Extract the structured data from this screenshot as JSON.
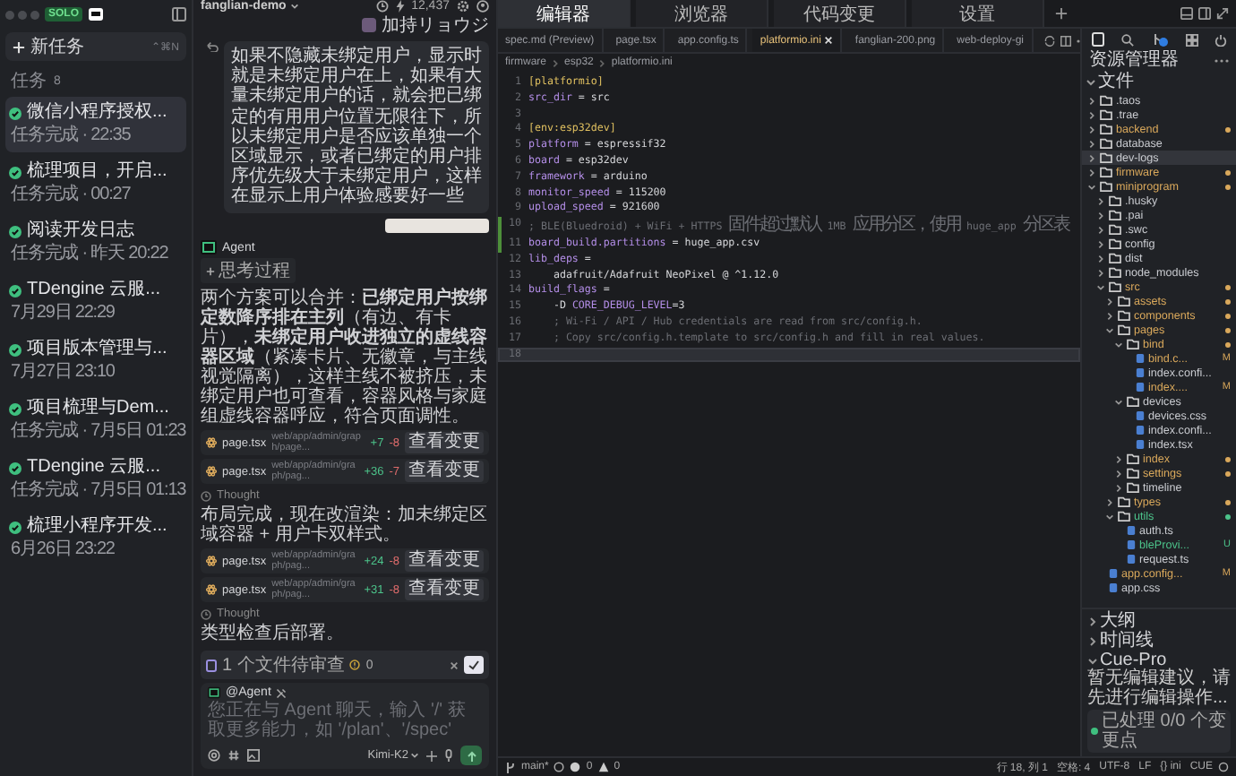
{
  "window": {
    "badge": "SOLO"
  },
  "sidebar": {
    "new_task": {
      "label": "新任务",
      "shortcut": "⌃⌘N"
    },
    "tasks_header": {
      "label": "任务",
      "count": "8"
    },
    "tasks": [
      {
        "title": "微信小程序授权...",
        "subtitle": "任务完成 · 22:35",
        "selected": true
      },
      {
        "title": "梳理项目，开启...",
        "subtitle": "任务完成 · 00:27",
        "selected": false
      },
      {
        "title": "阅读开发日志",
        "subtitle": "任务完成 · 昨天 20:22",
        "selected": false
      },
      {
        "title": "TDengine 云服...",
        "subtitle": "7月29日 22:29",
        "selected": false
      },
      {
        "title": "项目版本管理与...",
        "subtitle": "7月27日 23:10",
        "selected": false
      },
      {
        "title": "项目梳理与Dem...",
        "subtitle": "任务完成 · 7月5日 01:23",
        "selected": false
      },
      {
        "title": "TDengine 云服...",
        "subtitle": "任务完成 · 7月5日 01:13",
        "selected": false
      },
      {
        "title": "梳理小程序开发...",
        "subtitle": "6月26日 23:22",
        "selected": false
      }
    ]
  },
  "chat": {
    "project": "fanglian-demo",
    "tokens": "12,437",
    "user": "加持リョウジ",
    "user_message": "如果不隐藏未绑定用户，显示时就是未绑定用户在上，如果有大量未绑定用户的话，就会把已绑定的有用用户位置无限往下，所以未绑定用户是否应该单独一个区域显示，或者已绑定的用户排序优先级大于未绑定用户，这样在显示上用户体验感要好一些",
    "agent": "Agent",
    "items": [
      {
        "kind": "thinking",
        "text": "思考过程"
      },
      {
        "kind": "paragraph",
        "text": "两个方案可以合并：**已绑定用户按绑定数降序排在主列**（有边、有卡片），**未绑定用户收进独立的虚线容器区域**（紧凑卡片、无徽章，与主线视觉隔离），这样主线不被挤压，未绑定用户也可查看，容器风格与家庭组虚线容器呼应，符合页面调性。"
      },
      {
        "kind": "file",
        "name": "page.tsx",
        "path": "web/app/admin/graph/page...",
        "added": "+7",
        "removed": "-8",
        "action": "查看变更"
      },
      {
        "kind": "file",
        "name": "page.tsx",
        "path": "web/app/admin/graph/pag...",
        "added": "+36",
        "removed": "-7",
        "action": "查看变更"
      },
      {
        "kind": "thought",
        "text": "Thought"
      },
      {
        "kind": "paragraph",
        "text": "布局完成，现在改渲染：加未绑定区域容器 + 用户卡双样式。"
      },
      {
        "kind": "file",
        "name": "page.tsx",
        "path": "web/app/admin/graph/pag...",
        "added": "+24",
        "removed": "-8",
        "action": "查看变更"
      },
      {
        "kind": "file",
        "name": "page.tsx",
        "path": "web/app/admin/graph/pag...",
        "added": "+31",
        "removed": "-8",
        "action": "查看变更"
      },
      {
        "kind": "thought",
        "text": "Thought"
      },
      {
        "kind": "paragraph",
        "text": "类型检查后部署。"
      }
    ],
    "input": {
      "pending": "1 个文件待审查",
      "warnings": "0",
      "mention": "@Agent",
      "placeholder": "您正在与 Agent 聊天，输入 '/' 获取更多能力，如 '/plan'、'/spec'",
      "model": "Kimi-K2"
    }
  },
  "top_tabs": [
    {
      "label": "编辑器",
      "selected": true
    },
    {
      "label": "浏览器",
      "selected": false
    },
    {
      "label": "代码变更",
      "selected": false
    },
    {
      "label": "设置",
      "selected": false
    }
  ],
  "editor": {
    "tabs": [
      {
        "label": "spec.md (Preview)",
        "selected": false
      },
      {
        "label": "page.tsx",
        "selected": false
      },
      {
        "label": "app.config.ts",
        "selected": false
      },
      {
        "label": "platformio.ini",
        "selected": true
      },
      {
        "label": "fanglian-200.png",
        "selected": false
      },
      {
        "label": "web-deploy-gi",
        "selected": false
      }
    ],
    "breadcrumb": [
      "firmware",
      "esp32",
      "platformio.ini"
    ],
    "lines": [
      {
        "number": "1",
        "parts": [
          {
            "text": "[platformio]",
            "kind": "section"
          }
        ],
        "changed": false,
        "current": false
      },
      {
        "number": "2",
        "parts": [
          {
            "text": "src_dir",
            "kind": "key"
          },
          {
            "text": " = src",
            "kind": "value"
          }
        ],
        "changed": false,
        "current": false
      },
      {
        "number": "3",
        "changed": false,
        "current": false
      },
      {
        "number": "4",
        "parts": [
          {
            "text": "[env:esp32dev]",
            "kind": "section"
          }
        ],
        "changed": false,
        "current": false
      },
      {
        "number": "5",
        "parts": [
          {
            "text": "platform",
            "kind": "key"
          },
          {
            "text": " = espressif32",
            "kind": "value"
          }
        ],
        "changed": false,
        "current": false
      },
      {
        "number": "6",
        "parts": [
          {
            "text": "board",
            "kind": "key"
          },
          {
            "text": " = esp32dev",
            "kind": "value"
          }
        ],
        "changed": false,
        "current": false
      },
      {
        "number": "7",
        "parts": [
          {
            "text": "framework",
            "kind": "key"
          },
          {
            "text": " = arduino",
            "kind": "value"
          }
        ],
        "changed": false,
        "current": false
      },
      {
        "number": "8",
        "parts": [
          {
            "text": "monitor_speed",
            "kind": "key"
          },
          {
            "text": " = 115200",
            "kind": "value"
          }
        ],
        "changed": false,
        "current": false
      },
      {
        "number": "9",
        "parts": [
          {
            "text": "upload_speed",
            "kind": "key"
          },
          {
            "text": " = 921600",
            "kind": "value"
          }
        ],
        "changed": false,
        "current": false
      },
      {
        "number": "10",
        "parts": [
          {
            "text": "; BLE(Bluedroid) + WiFi + HTTPS 固件超过默认 1MB 应用分区，使用 huge_app 分区表",
            "kind": "comment"
          }
        ],
        "changed": true,
        "current": false
      },
      {
        "number": "11",
        "parts": [
          {
            "text": "board_build.partitions",
            "kind": "key"
          },
          {
            "text": " = huge_app.csv",
            "kind": "value"
          }
        ],
        "changed": true,
        "current": false
      },
      {
        "number": "12",
        "parts": [
          {
            "text": "lib_deps",
            "kind": "key"
          },
          {
            "text": " =",
            "kind": "value"
          }
        ],
        "changed": false,
        "current": false
      },
      {
        "number": "13",
        "parts": [
          {
            "text": "    adafruit/Adafruit NeoPixel @ ^1.12.0",
            "kind": "value"
          }
        ],
        "changed": false,
        "current": false
      },
      {
        "number": "14",
        "parts": [
          {
            "text": "build_flags",
            "kind": "key"
          },
          {
            "text": " =",
            "kind": "value"
          }
        ],
        "changed": false,
        "current": false
      },
      {
        "number": "15",
        "parts": [
          {
            "text": "    -D ",
            "kind": "value"
          },
          {
            "text": "CORE_DEBUG_LEVEL",
            "kind": "key"
          },
          {
            "text": "=3",
            "kind": "value"
          }
        ],
        "changed": false,
        "current": false
      },
      {
        "number": "16",
        "parts": [
          {
            "text": "    ; Wi-Fi / API / Hub credentials are read from src/config.h.",
            "kind": "comment"
          }
        ],
        "changed": false,
        "current": false
      },
      {
        "number": "17",
        "parts": [
          {
            "text": "    ; Copy src/config.h.template to src/config.h and fill in real values.",
            "kind": "comment"
          }
        ],
        "changed": false,
        "current": false
      },
      {
        "number": "18",
        "changed": false,
        "current": true
      }
    ]
  },
  "explorer": {
    "title": "资源管理器",
    "section": "文件",
    "tree": [
      {
        "kind": "folder",
        "name": ".taos",
        "expanded": false,
        "modified": false,
        "untracked": false,
        "selected": false
      },
      {
        "kind": "folder",
        "name": ".trae",
        "expanded": false,
        "modified": false,
        "untracked": false,
        "selected": false
      },
      {
        "kind": "folder",
        "name": "backend",
        "expanded": false,
        "modified": true,
        "untracked": false,
        "selected": false
      },
      {
        "kind": "folder",
        "name": "database",
        "expanded": false,
        "modified": false,
        "untracked": false,
        "selected": false
      },
      {
        "kind": "folder",
        "name": "dev-logs",
        "expanded": false,
        "modified": false,
        "untracked": false,
        "selected": true
      },
      {
        "kind": "folder",
        "name": "firmware",
        "expanded": false,
        "modified": true,
        "untracked": false,
        "selected": false
      },
      {
        "kind": "folder",
        "name": "miniprogram",
        "expanded": true,
        "modified": true,
        "untracked": false,
        "selected": false,
        "children": [
          {
            "kind": "folder",
            "name": ".husky",
            "expanded": false,
            "modified": false,
            "untracked": false,
            "selected": false
          },
          {
            "kind": "folder",
            "name": ".pai",
            "expanded": false,
            "modified": false,
            "untracked": false,
            "selected": false
          },
          {
            "kind": "folder",
            "name": ".swc",
            "expanded": false,
            "modified": false,
            "untracked": false,
            "selected": false
          },
          {
            "kind": "folder",
            "name": "config",
            "expanded": false,
            "modified": false,
            "untracked": false,
            "selected": false
          },
          {
            "kind": "folder",
            "name": "dist",
            "expanded": false,
            "modified": false,
            "untracked": false,
            "selected": false
          },
          {
            "kind": "folder",
            "name": "node_modules",
            "expanded": false,
            "modified": false,
            "untracked": false,
            "selected": false
          },
          {
            "kind": "folder",
            "name": "src",
            "expanded": true,
            "modified": true,
            "untracked": false,
            "selected": false,
            "children": [
              {
                "kind": "folder",
                "name": "assets",
                "expanded": false,
                "modified": true,
                "untracked": false,
                "selected": false
              },
              {
                "kind": "folder",
                "name": "components",
                "expanded": false,
                "modified": true,
                "untracked": false,
                "selected": false
              },
              {
                "kind": "folder",
                "name": "pages",
                "expanded": true,
                "modified": true,
                "untracked": false,
                "selected": false,
                "children": [
                  {
                    "kind": "folder",
                    "name": "bind",
                    "expanded": true,
                    "modified": true,
                    "untracked": false,
                    "selected": false,
                    "children": [
                      {
                        "kind": "file",
                        "name": "bind.c...",
                        "modified": true,
                        "untracked": false,
                        "selected": false,
                        "badge": "M"
                      },
                      {
                        "kind": "file",
                        "name": "index.confi...",
                        "modified": false,
                        "untracked": false,
                        "selected": false
                      },
                      {
                        "kind": "file",
                        "name": "index....",
                        "modified": true,
                        "untracked": false,
                        "selected": false,
                        "badge": "M"
                      }
                    ]
                  },
                  {
                    "kind": "folder",
                    "name": "devices",
                    "expanded": true,
                    "modified": false,
                    "untracked": false,
                    "selected": false,
                    "children": [
                      {
                        "kind": "file",
                        "name": "devices.css",
                        "modified": false,
                        "untracked": false,
                        "selected": false
                      },
                      {
                        "kind": "file",
                        "name": "index.confi...",
                        "modified": false,
                        "untracked": false,
                        "selected": false
                      },
                      {
                        "kind": "file",
                        "name": "index.tsx",
                        "modified": false,
                        "untracked": false,
                        "selected": false
                      }
                    ]
                  },
                  {
                    "kind": "folder",
                    "name": "index",
                    "expanded": false,
                    "modified": true,
                    "untracked": false,
                    "selected": false
                  },
                  {
                    "kind": "folder",
                    "name": "settings",
                    "expanded": false,
                    "modified": true,
                    "untracked": false,
                    "selected": false
                  },
                  {
                    "kind": "folder",
                    "name": "timeline",
                    "expanded": false,
                    "modified": false,
                    "untracked": false,
                    "selected": false
                  }
                ]
              },
              {
                "kind": "folder",
                "name": "types",
                "expanded": false,
                "modified": true,
                "untracked": false,
                "selected": false
              },
              {
                "kind": "folder",
                "name": "utils",
                "expanded": true,
                "modified": false,
                "untracked": true,
                "selected": false,
                "children": [
                  {
                    "kind": "file",
                    "name": "auth.ts",
                    "modified": false,
                    "untracked": false,
                    "selected": false
                  },
                  {
                    "kind": "file",
                    "name": "bleProvi...",
                    "modified": false,
                    "untracked": true,
                    "selected": false,
                    "badge": "U"
                  },
                  {
                    "kind": "file",
                    "name": "request.ts",
                    "modified": false,
                    "untracked": false,
                    "selected": false
                  }
                ]
              }
            ]
          },
          {
            "kind": "file",
            "name": "app.config...",
            "modified": true,
            "untracked": false,
            "selected": false,
            "badge": "M"
          },
          {
            "kind": "file",
            "name": "app.css",
            "modified": false,
            "untracked": false,
            "selected": false
          }
        ]
      }
    ],
    "sections": [
      {
        "label": "大纲",
        "expanded": false
      },
      {
        "label": "时间线",
        "expanded": false
      },
      {
        "label": "Cue-Pro",
        "expanded": true
      }
    ],
    "cue_message": "暂无编辑建议，请先进行编辑操作...",
    "cue_status": "已处理 0/0 个变更点"
  },
  "status_bar": {
    "branch": "main*",
    "errors": "0",
    "warnings": "0",
    "right": [
      "行 18, 列 1",
      "空格: 4",
      "UTF-8",
      "LF",
      "{} ini",
      "CUE"
    ]
  }
}
